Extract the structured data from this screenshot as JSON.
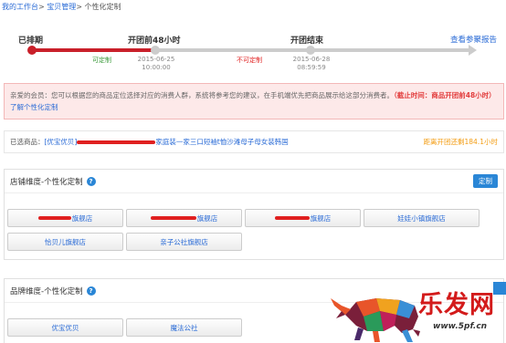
{
  "breadcrumb": {
    "home": "我的工作台",
    "sep1": ">",
    "section": "宝贝管理",
    "sep2": ">",
    "current": "个性化定制"
  },
  "timeline": {
    "steps": [
      {
        "label": "已排期",
        "date": "",
        "time": ""
      },
      {
        "label": "开团前48小时",
        "date": "2015-06-25",
        "time": "10:00:00"
      },
      {
        "label": "开团结束",
        "date": "2015-06-28",
        "time": "08:59:59"
      }
    ],
    "mark_customizable": "可定制",
    "mark_not_customizable": "不可定制",
    "report_link": "查看参聚报告",
    "colors": {
      "done": "#c9202a",
      "pending": "#cccccc",
      "ok": "#3a9a3a",
      "no": "#e02020"
    }
  },
  "alert": {
    "text": "亲爱的会员：您可以根据您的商品定位选择对应的消费人群，系统将参考您的建议，在手机端优先把商品展示给这部分消费者。",
    "deadline": "（截止时间：商品开团前48小时）",
    "link": "了解个性化定制"
  },
  "selected": {
    "label": "已选商品：",
    "product_prefix": "[优宝优贝]",
    "product_suffix": "家庭装一家三口短袖t恤沙滩母子母女装韩国",
    "remaining": "距离开团还剩184.1小时"
  },
  "shop_panel": {
    "title": "店铺维度-个性化定制",
    "help": "?",
    "button": "定制",
    "options": [
      {
        "label": "旗舰店",
        "redacted": true
      },
      {
        "label": "旗舰店",
        "redacted": true
      },
      {
        "label": "旗舰店",
        "redacted": true
      },
      {
        "label": "娃娃小镇旗舰店",
        "redacted": false
      },
      {
        "label": "恰贝儿旗舰店",
        "redacted": false
      },
      {
        "label": "亲子公社旗舰店",
        "redacted": false
      }
    ]
  },
  "brand_panel": {
    "title": "品牌维度-个性化定制",
    "help": "?",
    "options": [
      {
        "label": "优宝优贝"
      },
      {
        "label": "魔法公社"
      }
    ]
  },
  "watermark": {
    "text": "乐发网",
    "url": "www.5pf.cn"
  }
}
